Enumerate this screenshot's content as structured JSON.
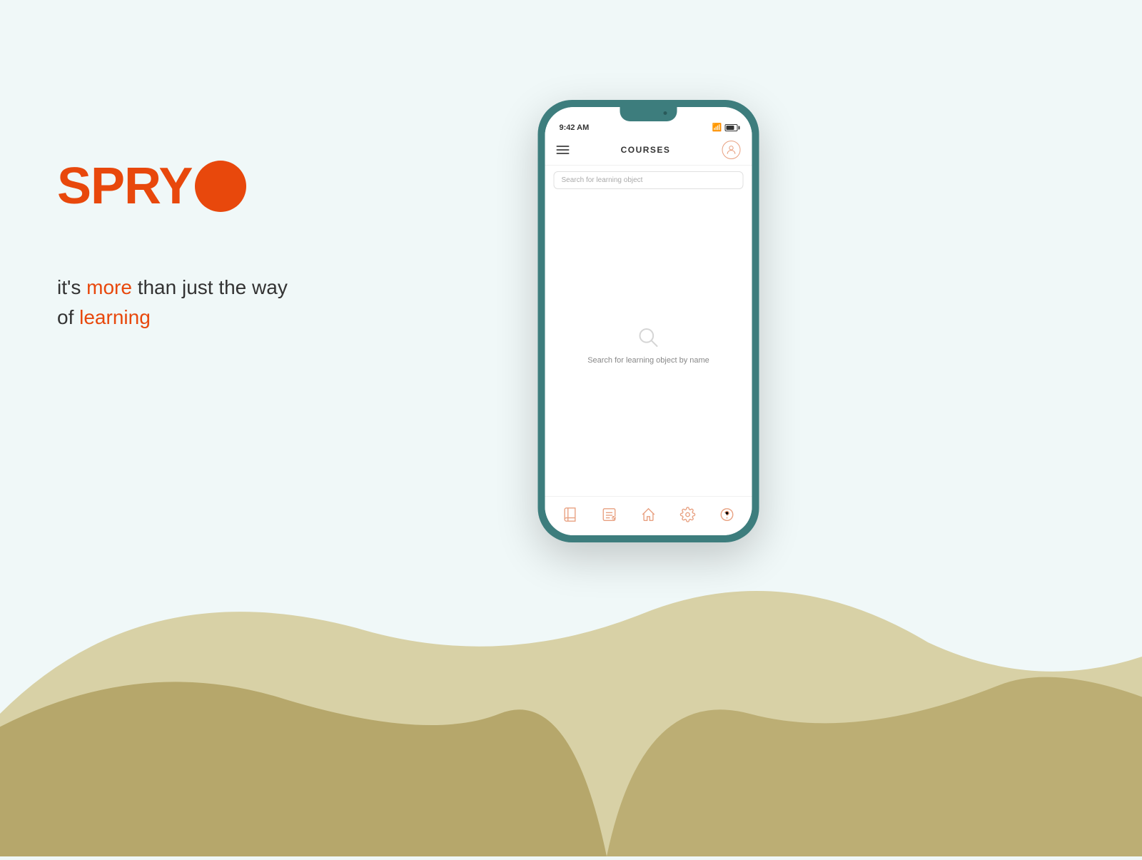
{
  "logo": {
    "text": "SPRY",
    "tagline_part1": "it's ",
    "tagline_more": "more",
    "tagline_part2": " than just the way",
    "tagline_part3": "of ",
    "tagline_learning": "learning"
  },
  "phone": {
    "status_time": "9:42 AM",
    "header_title": "COURSES",
    "search_placeholder": "Search for learning object",
    "empty_state_text": "Search for learning object by name",
    "nav_items": [
      {
        "name": "book",
        "label": "Book"
      },
      {
        "name": "list",
        "label": "List"
      },
      {
        "name": "home",
        "label": "Home"
      },
      {
        "name": "settings",
        "label": "Settings"
      },
      {
        "name": "help",
        "label": "Help"
      }
    ]
  },
  "colors": {
    "brand_orange": "#e8480c",
    "teal": "#3d7d7d",
    "sand_light": "#c8b870",
    "sand_dark": "#b0a060"
  }
}
